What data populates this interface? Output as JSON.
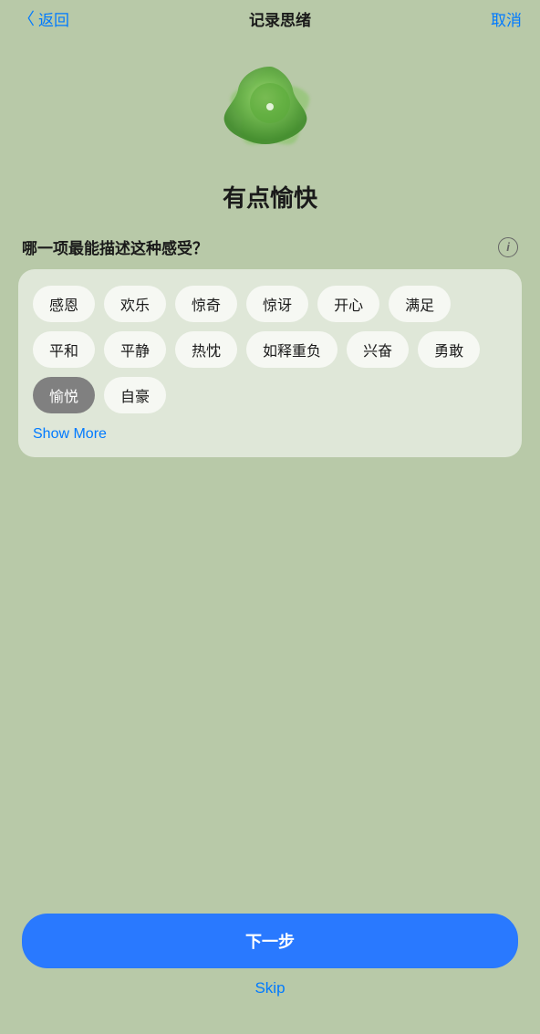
{
  "nav": {
    "back_label": "返回",
    "title": "记录思绪",
    "cancel_label": "取消"
  },
  "mood": {
    "title": "有点愉快",
    "flower_color_outer": "#8fbc6a",
    "flower_color_inner": "#5a9e3a",
    "flower_color_center": "#2e7d1e"
  },
  "question": {
    "text": "哪一项最能描述这种感受？",
    "info_icon_label": "i"
  },
  "tags": [
    {
      "id": "t1",
      "label": "感恩",
      "selected": false
    },
    {
      "id": "t2",
      "label": "欢乐",
      "selected": false
    },
    {
      "id": "t3",
      "label": "惊奇",
      "selected": false
    },
    {
      "id": "t4",
      "label": "惊讶",
      "selected": false
    },
    {
      "id": "t5",
      "label": "开心",
      "selected": false
    },
    {
      "id": "t6",
      "label": "满足",
      "selected": false
    },
    {
      "id": "t7",
      "label": "平和",
      "selected": false
    },
    {
      "id": "t8",
      "label": "平静",
      "selected": false
    },
    {
      "id": "t9",
      "label": "热忱",
      "selected": false
    },
    {
      "id": "t10",
      "label": "如释重负",
      "selected": false
    },
    {
      "id": "t11",
      "label": "兴奋",
      "selected": false
    },
    {
      "id": "t12",
      "label": "勇敢",
      "selected": false
    },
    {
      "id": "t13",
      "label": "愉悦",
      "selected": true
    },
    {
      "id": "t14",
      "label": "自豪",
      "selected": false
    }
  ],
  "show_more_label": "Show More",
  "actions": {
    "next_label": "下一步",
    "skip_label": "Skip"
  }
}
